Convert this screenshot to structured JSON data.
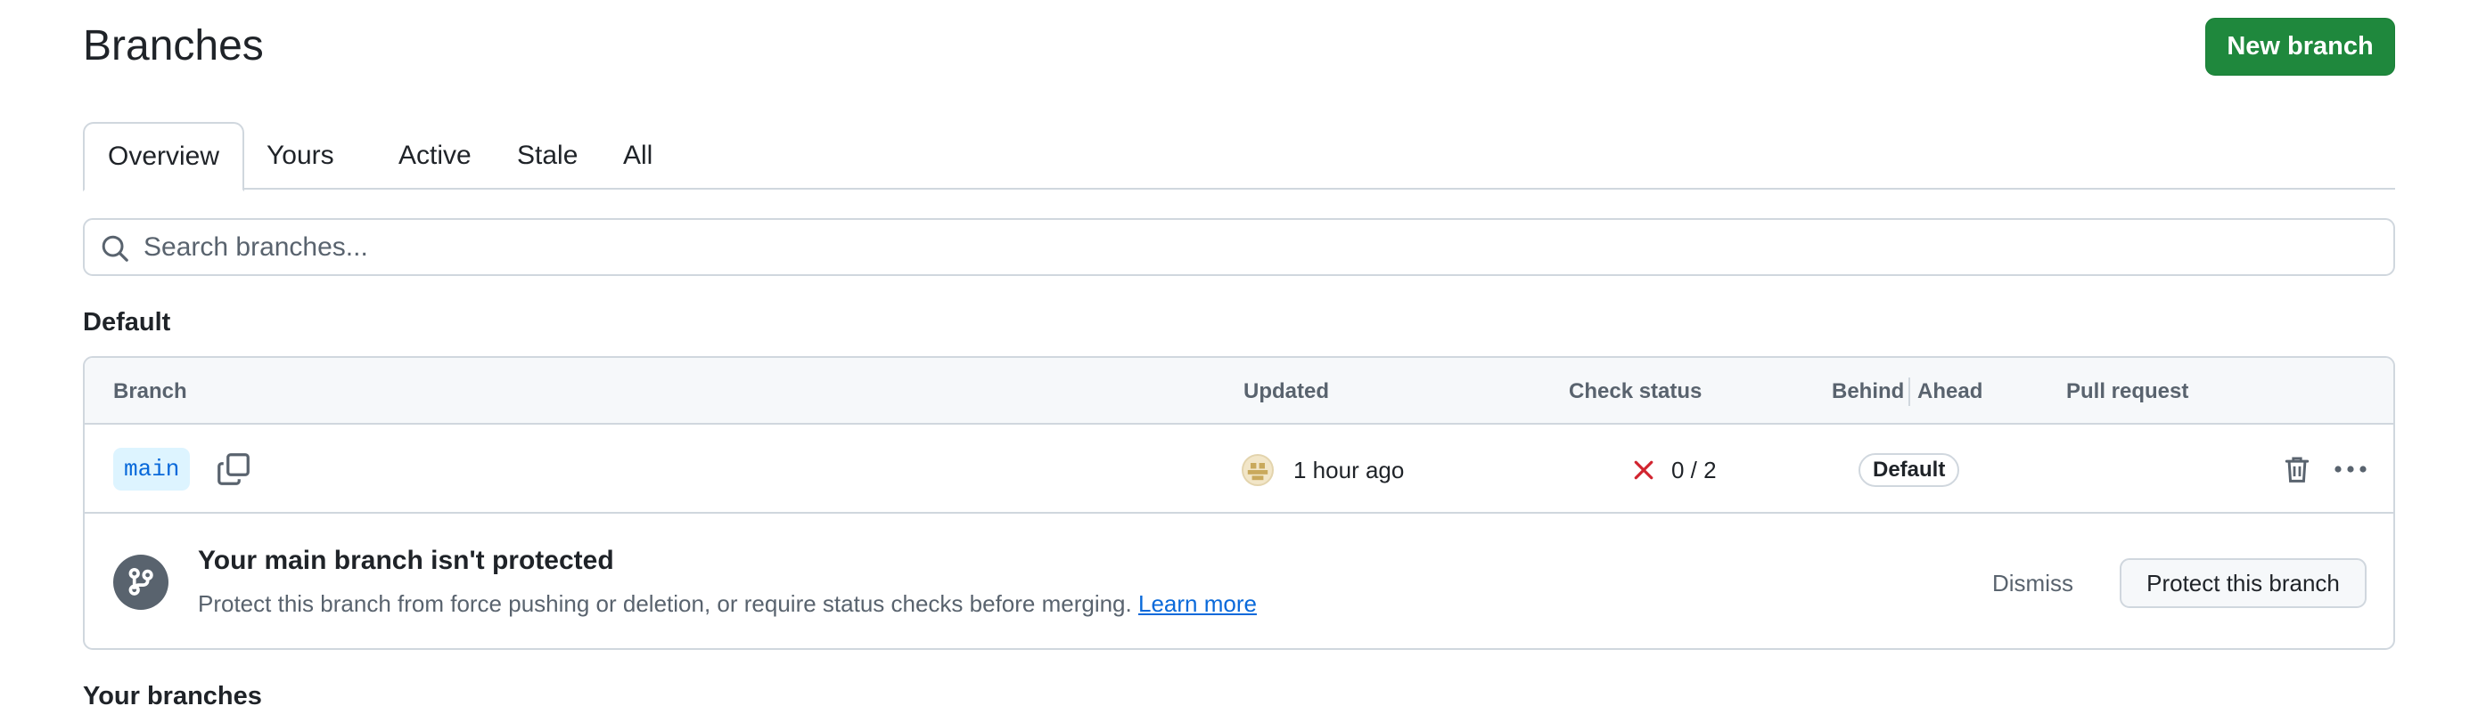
{
  "header": {
    "title": "Branches",
    "new_branch_label": "New branch"
  },
  "tabs": [
    {
      "label": "Overview",
      "active": true
    },
    {
      "label": "Yours"
    },
    {
      "label": "Active"
    },
    {
      "label": "Stale"
    },
    {
      "label": "All"
    }
  ],
  "search": {
    "placeholder": "Search branches..."
  },
  "sections": {
    "default_title": "Default",
    "yours_title": "Your branches"
  },
  "table": {
    "columns": {
      "branch": "Branch",
      "updated": "Updated",
      "check_status": "Check status",
      "behind": "Behind",
      "ahead": "Ahead",
      "pull_request": "Pull request"
    },
    "rows": [
      {
        "branch": "main",
        "updated": "1 hour ago",
        "check_count": "0 / 2",
        "badge": "Default"
      }
    ]
  },
  "protect_banner": {
    "title": "Your main branch isn't protected",
    "description": "Protect this branch from force pushing or deletion, or require status checks before merging.",
    "learn_more": "Learn more",
    "dismiss_label": "Dismiss",
    "protect_label": "Protect this branch"
  },
  "icons": {
    "search": "search-icon",
    "copy": "copy-icon",
    "check_fail": "x-icon",
    "trash": "trash-icon",
    "more": "kebab-horizontal-icon",
    "branch": "git-branch-icon"
  },
  "colors": {
    "primary_button": "#1f883d",
    "link": "#0969da",
    "branch_pill_bg": "#ddf4ff",
    "fail": "#d1242f"
  }
}
